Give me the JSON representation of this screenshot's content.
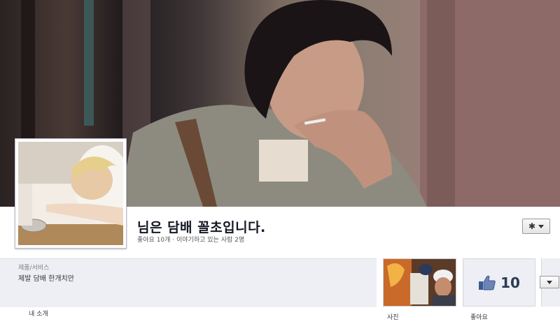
{
  "page": {
    "title": "님은 담배 꼴초입니다.",
    "stats": "좋아요 10개 · 이야기하고 있는 사람 2명"
  },
  "about": {
    "category": "제품/서비스",
    "description": "제발 담배 한개치만"
  },
  "tiles": {
    "like_count": "10",
    "photos_label": "사진",
    "likes_label": "좋아요"
  },
  "tabs": {
    "about_label": "내 소개"
  },
  "icons": {
    "gear": "gear-icon",
    "thumb": "thumbs-up-icon",
    "caret": "chevron-down-icon"
  },
  "colors": {
    "panel_bg": "#edeff4",
    "title_text": "#141823",
    "like_count_text": "#2d3a55",
    "thumb_blue": "#3b5998"
  }
}
